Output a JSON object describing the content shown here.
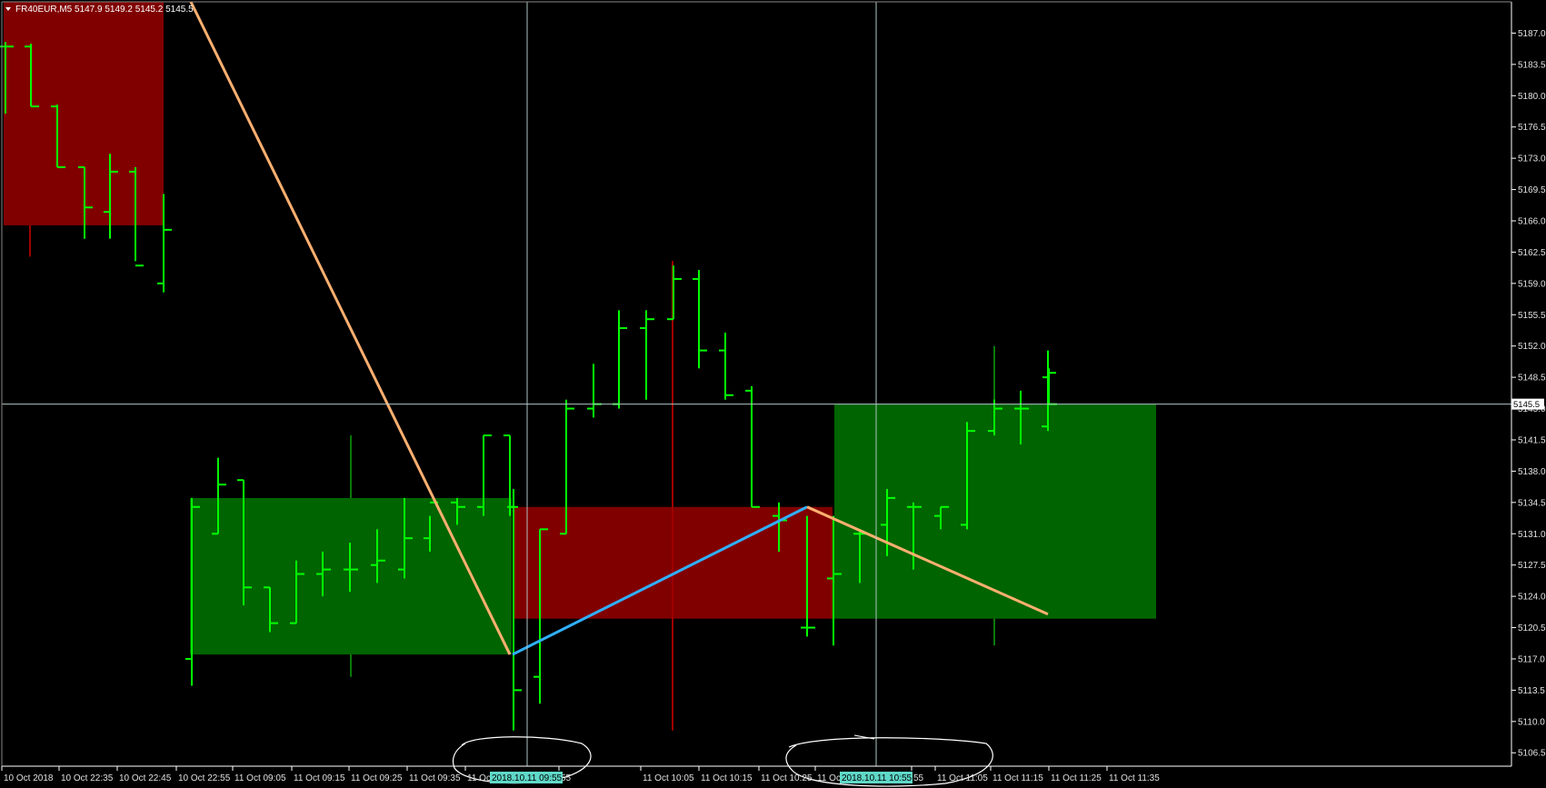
{
  "header": {
    "symbol": "FR40EUR,M5",
    "ohlc": "5147.9 5149.2 5145.2 5145.5",
    "menu_icon": "triangle-down-icon"
  },
  "chart_data": {
    "type": "ohlc",
    "symbol": "FR40EUR",
    "timeframe": "M5",
    "ylim": [
      5105.0,
      5190.5
    ],
    "grid": false,
    "y_ticks": [
      "5187.0",
      "5183.5",
      "5180.0",
      "5176.5",
      "5173.0",
      "5169.5",
      "5166.0",
      "5162.5",
      "5159.0",
      "5155.5",
      "5152.0",
      "5148.5",
      "5145.0",
      "5141.5",
      "5138.0",
      "5134.5",
      "5131.0",
      "5127.5",
      "5124.0",
      "5120.5",
      "5117.0",
      "5113.5",
      "5110.0",
      "5106.5"
    ],
    "x_ticks": [
      "10 Oct 2018",
      "10 Oct 22:35",
      "10 Oct 22:45",
      "10 Oct 22:55",
      "11 Oct 09:05",
      "11 Oct 09:15",
      "11 Oct 09:25",
      "11 Oct 09:35",
      "11 Oc",
      "55",
      "11 Oct 10:05",
      "11 Oct 10:15",
      "11 Oct 10:25",
      "11 Oct 10:35",
      "55",
      "11 Oct 11:05",
      "11 Oct 11:15",
      "11 Oct 11:25",
      "11 Oct 11:35"
    ],
    "x_markers": [
      "2018.10.11 09:55",
      "2018.10.11 10:55"
    ],
    "current_price": "5145.5",
    "bars": [
      {
        "o": 5185.5,
        "h": 5186.0,
        "l": 5178.0,
        "c": 5185.5
      },
      {
        "o": 5185.5,
        "h": 5185.8,
        "l": 5178.8,
        "c": 5178.8
      },
      {
        "o": 5178.8,
        "h": 5179.0,
        "l": 5172.0,
        "c": 5172.0
      },
      {
        "o": 5172.0,
        "h": 5172.0,
        "l": 5164.0,
        "c": 5167.5
      },
      {
        "o": 5167.0,
        "h": 5173.5,
        "l": 5164.0,
        "c": 5171.5
      },
      {
        "o": 5171.5,
        "h": 5172.0,
        "l": 5161.5,
        "c": 5161.0
      },
      {
        "o": 5159.0,
        "h": 5169.0,
        "l": 5158.0,
        "c": 5165.0
      },
      {
        "o": 5117.0,
        "h": 5135.0,
        "l": 5114.0,
        "c": 5134.0
      },
      {
        "o": 5131.0,
        "h": 5139.5,
        "l": 5131.0,
        "c": 5136.5
      },
      {
        "o": 5137.0,
        "h": 5137.0,
        "l": 5123.0,
        "c": 5125.0
      },
      {
        "o": 5125.0,
        "h": 5125.0,
        "l": 5120.0,
        "c": 5121.0
      },
      {
        "o": 5121.0,
        "h": 5128.0,
        "l": 5121.0,
        "c": 5126.5
      },
      {
        "o": 5126.5,
        "h": 5129.0,
        "l": 5124.0,
        "c": 5127.0
      },
      {
        "o": 5127.0,
        "h": 5130.0,
        "l": 5124.5,
        "c": 5127.0
      },
      {
        "o": 5127.5,
        "h": 5131.5,
        "l": 5125.5,
        "c": 5128.0
      },
      {
        "o": 5127.0,
        "h": 5135.0,
        "l": 5126.0,
        "c": 5130.5
      },
      {
        "o": 5130.5,
        "h": 5133.0,
        "l": 5129.0,
        "c": 5134.5
      },
      {
        "o": 5134.5,
        "h": 5135.0,
        "l": 5132.0,
        "c": 5134.0
      },
      {
        "o": 5134.0,
        "h": 5142.0,
        "l": 5133.0,
        "c": 5142.0
      },
      {
        "o": 5142.0,
        "h": 5142.0,
        "l": 5133.0,
        "c": 5134.0
      },
      {
        "o": 5134.0,
        "h": 5136.0,
        "l": 5109.0,
        "c": 5113.5
      },
      {
        "o": 5115.0,
        "h": 5131.5,
        "l": 5112.0,
        "c": 5131.5
      },
      {
        "o": 5131.0,
        "h": 5146.0,
        "l": 5131.0,
        "c": 5145.0
      },
      {
        "o": 5145.0,
        "h": 5150.0,
        "l": 5144.0,
        "c": 5145.5
      },
      {
        "o": 5145.5,
        "h": 5156.0,
        "l": 5145.0,
        "c": 5154.0
      },
      {
        "o": 5154.0,
        "h": 5156.0,
        "l": 5146.0,
        "c": 5155.0
      },
      {
        "o": 5155.0,
        "h": 5161.0,
        "l": 5155.0,
        "c": 5159.5
      },
      {
        "o": 5159.5,
        "h": 5160.5,
        "l": 5149.5,
        "c": 5151.5
      },
      {
        "o": 5151.5,
        "h": 5153.5,
        "l": 5146.0,
        "c": 5146.5
      },
      {
        "o": 5147.0,
        "h": 5147.5,
        "l": 5134.0,
        "c": 5134.0
      },
      {
        "o": 5133.0,
        "h": 5134.5,
        "l": 5129.0,
        "c": 5132.5
      },
      {
        "o": 5120.5,
        "h": 5133.0,
        "l": 5119.5,
        "c": 5120.5
      },
      {
        "o": 5126.0,
        "h": 5133.0,
        "l": 5118.5,
        "c": 5126.5
      },
      {
        "o": 5131.0,
        "h": 5131.5,
        "l": 5125.5,
        "c": 5131.0
      },
      {
        "o": 5132.0,
        "h": 5136.0,
        "l": 5128.5,
        "c": 5135.0
      },
      {
        "o": 5134.0,
        "h": 5134.5,
        "l": 5127.0,
        "c": 5134.0
      },
      {
        "o": 5133.0,
        "h": 5134.0,
        "l": 5131.5,
        "c": 5134.0
      },
      {
        "o": 5132.0,
        "h": 5143.5,
        "l": 5131.5,
        "c": 5142.5
      },
      {
        "o": 5142.5,
        "h": 5146.0,
        "l": 5142.0,
        "c": 5145.0
      },
      {
        "o": 5145.0,
        "h": 5147.0,
        "l": 5141.0,
        "c": 5145.0
      },
      {
        "o": 5143.0,
        "h": 5151.5,
        "l": 5142.5,
        "c": 5149.0
      },
      {
        "o": 5148.5,
        "h": 5149.5,
        "l": 5145.5,
        "c": 5145.5
      }
    ],
    "zones": [
      {
        "kind": "bear",
        "y_top": 5190.5,
        "y_bottom": 5165.5,
        "wick_low": 5162.0
      },
      {
        "kind": "bull",
        "y_top": 5135.0,
        "y_bottom": 5117.5,
        "wick_high": 5142.0,
        "wick_low": 5115.0
      },
      {
        "kind": "bear",
        "y_top": 5134.0,
        "y_bottom": 5121.5,
        "wick_high": 5161.5,
        "wick_low": 5109.0
      },
      {
        "kind": "bull",
        "y_top": 5145.5,
        "y_bottom": 5121.5,
        "wick_high": 5152.0,
        "wick_low": 5118.5
      }
    ],
    "lines": [
      {
        "color": "orange",
        "from": {
          "bar": -1,
          "y": 5190.5
        },
        "to": {
          "bar": 19,
          "y": 5117.5
        }
      },
      {
        "color": "blue",
        "from": {
          "bar": 19,
          "y": 5117.5
        },
        "to": {
          "bar": 31,
          "y": 5134.0
        }
      },
      {
        "color": "orange",
        "from": {
          "bar": 31,
          "y": 5134.0
        },
        "to": {
          "bar": 40,
          "y": 5122.0
        }
      }
    ]
  },
  "colors": {
    "background": "#000000",
    "bar": "#00ff00",
    "bull_zone": "#006400",
    "bear_zone": "#800000",
    "crosshair": "#b0c4c4",
    "trend_orange": "#ffb070",
    "trend_blue": "#30b0ff",
    "marker_bg": "#5fd8c8",
    "axis": "#ffffff"
  }
}
